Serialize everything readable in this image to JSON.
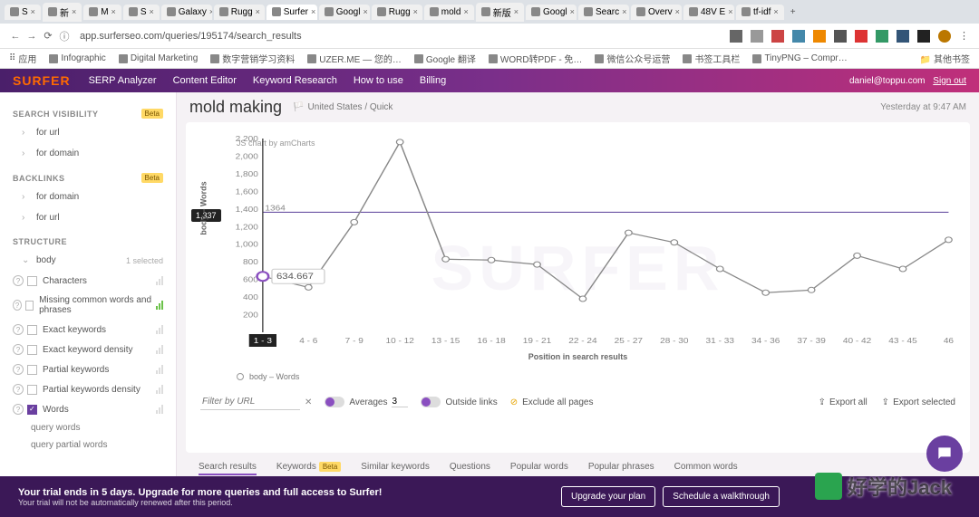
{
  "browser": {
    "tabs": [
      {
        "label": "S"
      },
      {
        "label": "新"
      },
      {
        "label": "M"
      },
      {
        "label": "S"
      },
      {
        "label": "Galaxy"
      },
      {
        "label": "Rugg"
      },
      {
        "label": "Surfer",
        "active": true
      },
      {
        "label": "Googl"
      },
      {
        "label": "Rugg"
      },
      {
        "label": "mold"
      },
      {
        "label": "新版"
      },
      {
        "label": "Googl"
      },
      {
        "label": "Searc"
      },
      {
        "label": "Overv"
      },
      {
        "label": "48V E"
      },
      {
        "label": "tf-idf"
      }
    ],
    "url": "app.surferseo.com/queries/195174/search_results",
    "bookmarks": [
      "应用",
      "Infographic",
      "Digital Marketing",
      "数字营销学习资料",
      "UZER.ME — 您的…",
      "Google 翻译",
      "WORD转PDF - 免…",
      "微信公众号运营",
      "书签工具栏",
      "TinyPNG – Compr…"
    ],
    "bookmarks_other": "其他书签"
  },
  "nav": {
    "logo": "SURFER",
    "items": [
      "SERP Analyzer",
      "Content Editor",
      "Keyword Research",
      "How to use",
      "Billing"
    ],
    "email": "daniel@toppu.com",
    "signout": "Sign out"
  },
  "sidebar": {
    "sections": {
      "visibility": {
        "title": "SEARCH VISIBILITY",
        "badge": "Beta",
        "items": [
          "for url",
          "for domain"
        ]
      },
      "backlinks": {
        "title": "BACKLINKS",
        "badge": "Beta",
        "items": [
          "for domain",
          "for url"
        ]
      },
      "structure": {
        "title": "STRUCTURE"
      }
    },
    "body_label": "body",
    "selected": "1 selected",
    "struct_items": [
      {
        "label": "Characters"
      },
      {
        "label": "Missing common words and phrases",
        "green": true
      },
      {
        "label": "Exact keywords"
      },
      {
        "label": "Exact keyword density"
      },
      {
        "label": "Partial keywords"
      },
      {
        "label": "Partial keywords density"
      },
      {
        "label": "Words",
        "checked": true
      }
    ],
    "sub_items": [
      "query words",
      "query partial words"
    ]
  },
  "page": {
    "title": "mold making",
    "locale": "United States / Quick",
    "timestamp": "Yesterday at 9:47 AM"
  },
  "chart_data": {
    "type": "line",
    "title": "",
    "xlabel": "Position in search results",
    "ylabel": "body – Words",
    "ylim": [
      0,
      2200
    ],
    "yticks": [
      200,
      400,
      600,
      800,
      1000,
      1200,
      1400,
      1600,
      1800,
      2000,
      2200
    ],
    "categories": [
      "1 - 3",
      "4 - 6",
      "7 - 9",
      "10 - 12",
      "13 - 15",
      "16 - 18",
      "19 - 21",
      "22 - 24",
      "25 - 27",
      "28 - 30",
      "31 - 33",
      "34 - 36",
      "37 - 39",
      "40 - 42",
      "43 - 45",
      "46"
    ],
    "series": [
      {
        "name": "body – Words",
        "values": [
          635,
          510,
          1250,
          2160,
          830,
          820,
          770,
          380,
          1130,
          1020,
          720,
          450,
          480,
          870,
          720,
          1050
        ]
      }
    ],
    "avg_line": 1364,
    "highlight": {
      "x_index": 0,
      "value": "634.667"
    },
    "left_badge": "1,337",
    "credit": "JS chart by amCharts"
  },
  "filters": {
    "placeholder": "Filter by URL",
    "averages": "Averages",
    "avg_n": "3",
    "outside": "Outside links",
    "exclude": "Exclude all pages",
    "export_all": "Export all",
    "export_sel": "Export selected"
  },
  "result_tabs": [
    "Search results",
    "Keywords",
    "Similar keywords",
    "Questions",
    "Popular words",
    "Popular phrases",
    "Common words"
  ],
  "result_tabs_badge": "Beta",
  "trial": {
    "headline": "Your trial ends in 5 days. Upgrade for more queries and full access to Surfer!",
    "sub": "Your trial will not be automatically renewed after this period.",
    "btn1": "Upgrade your plan",
    "btn2": "Schedule a walkthrough"
  },
  "watermark": "好学的Jack"
}
